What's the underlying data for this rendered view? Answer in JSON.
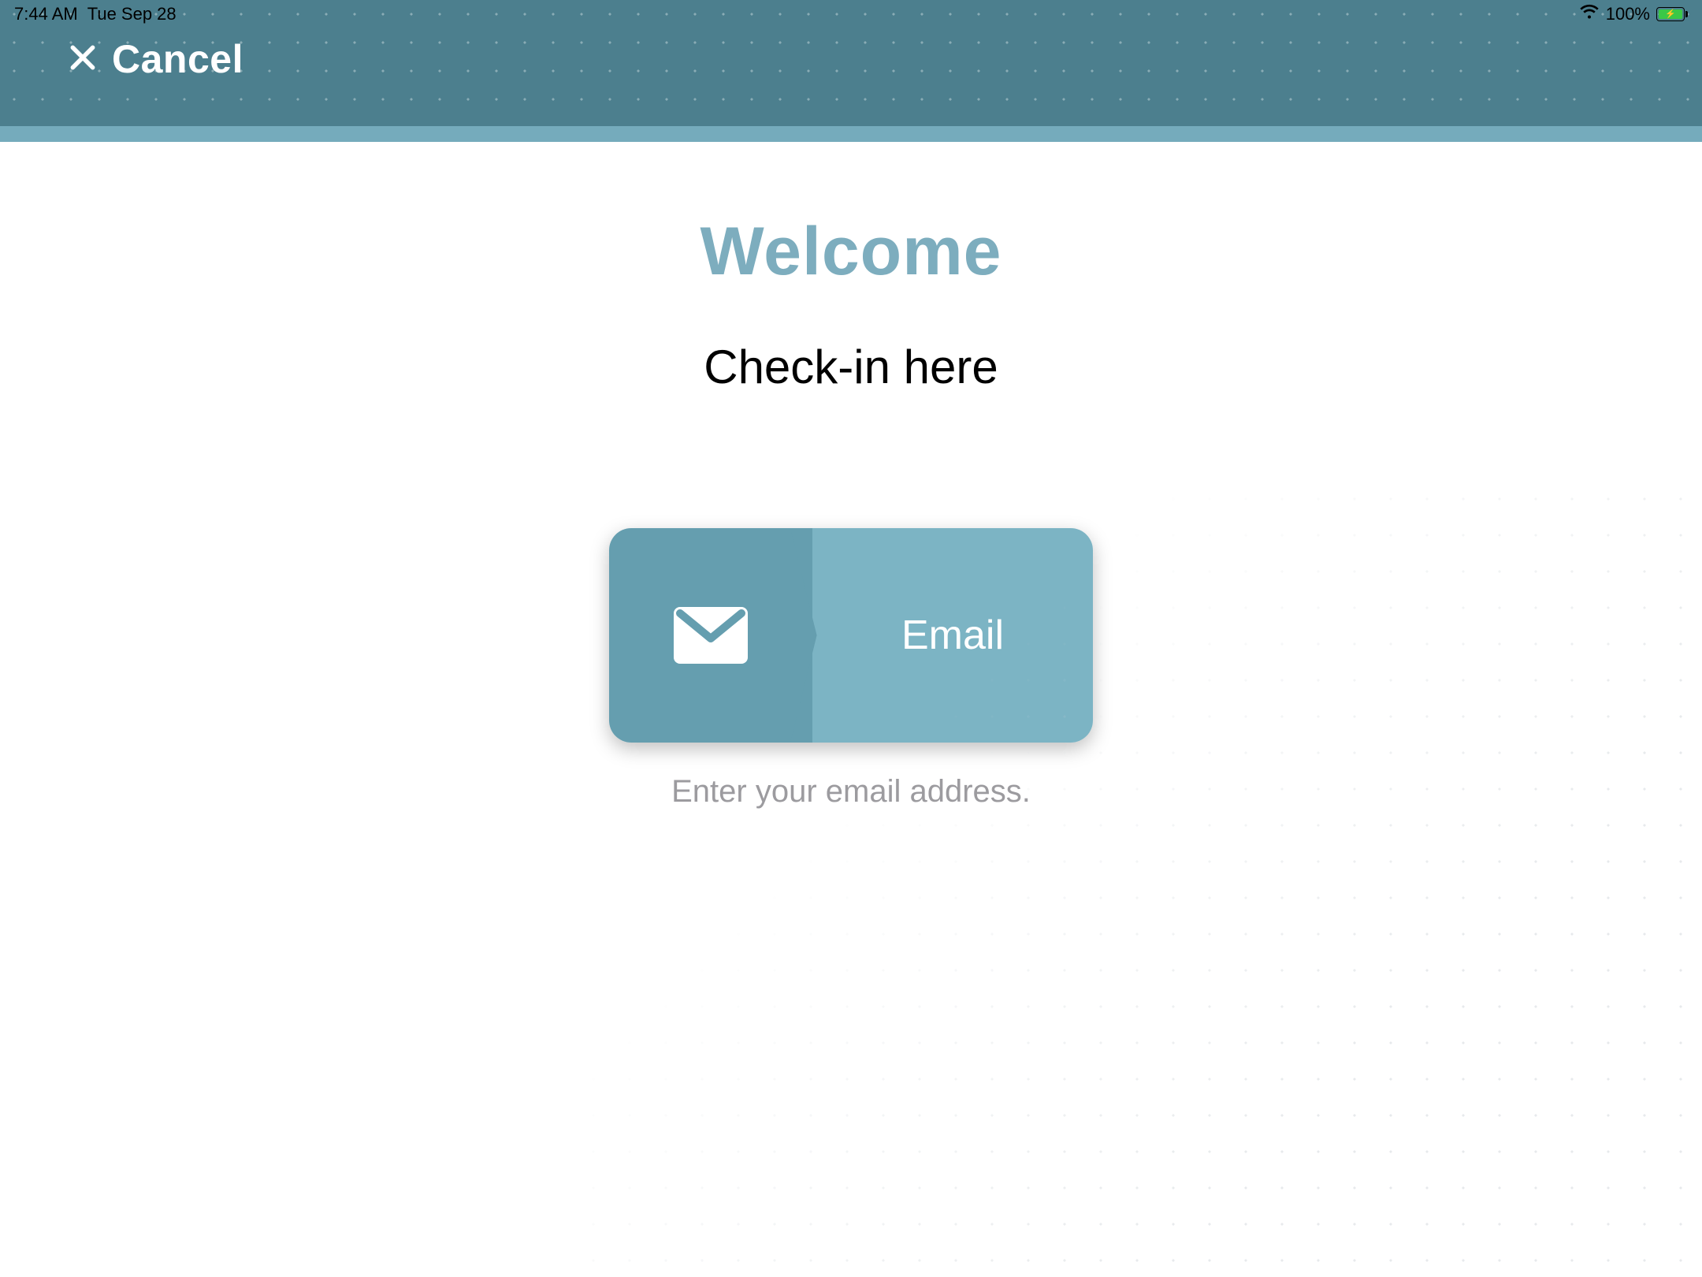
{
  "status": {
    "time": "7:44 AM",
    "date": "Tue Sep 28",
    "battery_pct": "100%"
  },
  "header": {
    "cancel_label": "Cancel"
  },
  "main": {
    "title": "Welcome",
    "subtitle": "Check-in here",
    "email_button_label": "Email",
    "email_hint": "Enter your email address."
  }
}
